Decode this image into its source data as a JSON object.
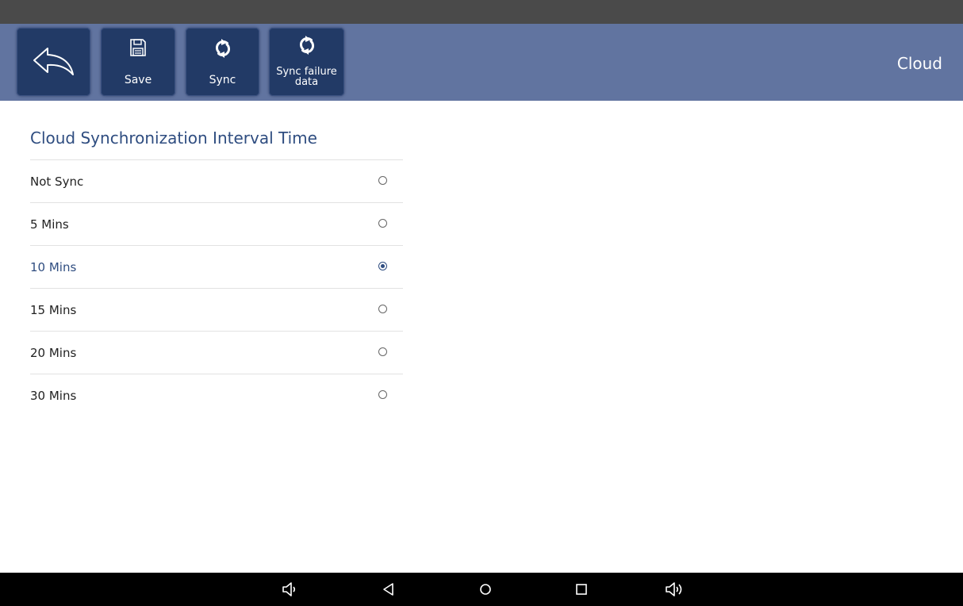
{
  "toolbar": {
    "back_icon": "back-arrow-icon",
    "save": {
      "label": "Save",
      "icon": "floppy-disk-icon"
    },
    "sync": {
      "label": "Sync",
      "icon": "sync-icon"
    },
    "sync_failure": {
      "label_line1": "Sync failure",
      "label_line2": "data",
      "icon": "sync-icon"
    },
    "title": "Cloud",
    "background_color": "#6174a0",
    "button_color": "#223a66"
  },
  "section": {
    "title": "Cloud Synchronization Interval Time",
    "options": [
      {
        "label": "Not Sync",
        "selected": false
      },
      {
        "label": "5 Mins",
        "selected": false
      },
      {
        "label": "10 Mins",
        "selected": true
      },
      {
        "label": "15 Mins",
        "selected": false
      },
      {
        "label": "20 Mins",
        "selected": false
      },
      {
        "label": "30 Mins",
        "selected": false
      }
    ],
    "accent_color": "#2f4d80"
  },
  "nav_bar": {
    "buttons": [
      "volume-down-icon",
      "back-icon",
      "home-icon",
      "recents-icon",
      "volume-up-icon"
    ]
  }
}
